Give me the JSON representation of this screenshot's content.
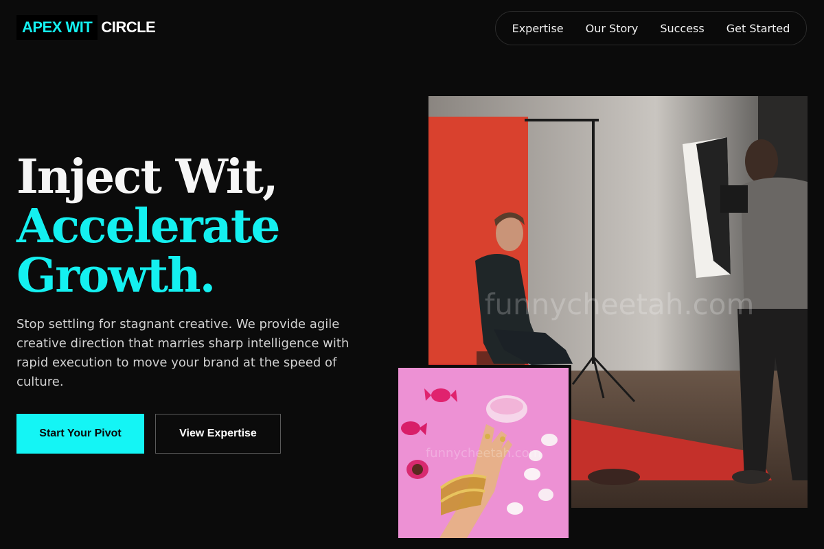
{
  "brand": {
    "name_part_a": "APEX WIT",
    "name_part_b": "CIRCLE",
    "accent_color": "#14f0f0"
  },
  "nav": {
    "items": [
      {
        "label": "Expertise"
      },
      {
        "label": "Our Story"
      },
      {
        "label": "Success"
      },
      {
        "label": "Get Started"
      }
    ]
  },
  "hero": {
    "headline_line1": "Inject Wit,",
    "headline_line2": "Accelerate",
    "headline_line3": "Growth.",
    "description": "Stop settling for stagnant creative. We provide agile creative direction that marries sharp intelligence with rapid execution to move your brand at the speed of culture.",
    "primary_cta": "Start Your Pivot",
    "secondary_cta": "View Expertise"
  },
  "images": {
    "studio_watermark": "funnycheetah.com",
    "pink_watermark": "funnycheetah.com"
  }
}
